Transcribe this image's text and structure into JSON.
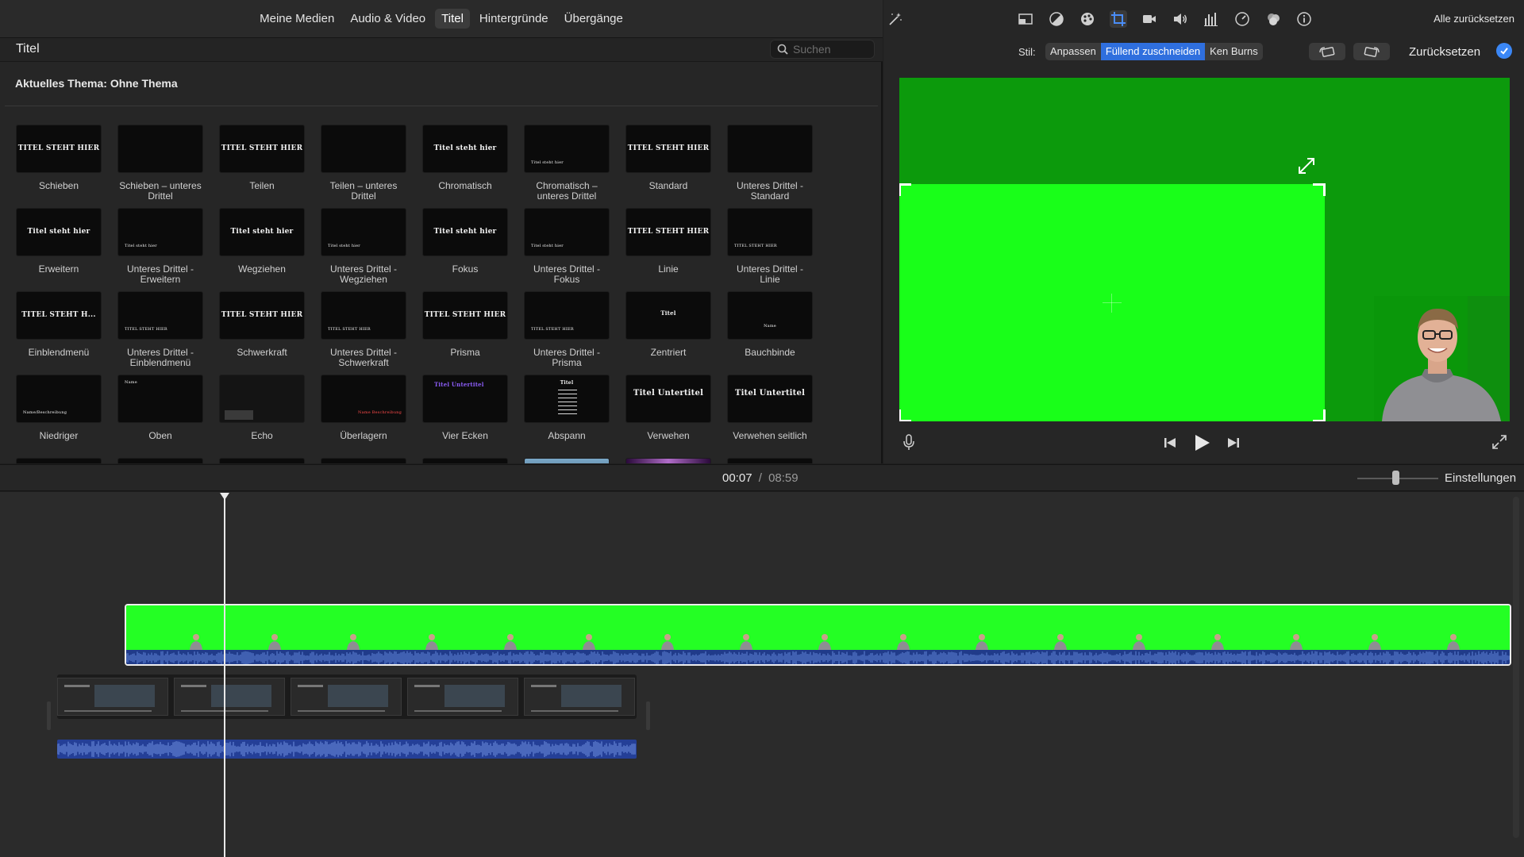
{
  "browser": {
    "tabs": [
      {
        "label": "Meine Medien",
        "active": false
      },
      {
        "label": "Audio & Video",
        "active": false
      },
      {
        "label": "Titel",
        "active": true
      },
      {
        "label": "Hintergründe",
        "active": false
      },
      {
        "label": "Übergänge",
        "active": false
      }
    ],
    "section_title": "Titel",
    "search_placeholder": "Suchen",
    "theme_title": "Aktuelles Thema: Ohne Thema",
    "titles": [
      {
        "label": "Schieben",
        "preview": "TITEL STEHT HIER"
      },
      {
        "label": "Schieben – unteres Drittel",
        "preview": ""
      },
      {
        "label": "Teilen",
        "preview": "TITEL STEHT HIER"
      },
      {
        "label": "Teilen – unteres Drittel",
        "preview": ""
      },
      {
        "label": "Chromatisch",
        "preview": "Titel steht hier"
      },
      {
        "label": "Chromatisch – unteres Drittel",
        "preview": "Titel steht hier"
      },
      {
        "label": "Standard",
        "preview": "TITEL STEHT HIER"
      },
      {
        "label": "Unteres Drittel - Standard",
        "preview": ""
      },
      {
        "label": "Erweitern",
        "preview": "Titel steht hier"
      },
      {
        "label": "Unteres Drittel - Erweitern",
        "preview": "Titel steht hier"
      },
      {
        "label": "Wegziehen",
        "preview": "Titel steht hier"
      },
      {
        "label": "Unteres Drittel - Wegziehen",
        "preview": "Titel steht hier"
      },
      {
        "label": "Fokus",
        "preview": "Titel steht hier"
      },
      {
        "label": "Unteres Drittel - Fokus",
        "preview": "Titel steht hier"
      },
      {
        "label": "Linie",
        "preview": "TITEL STEHT HIER"
      },
      {
        "label": "Unteres Drittel - Linie",
        "preview": "TITEL STEHT HIER"
      },
      {
        "label": "Einblendmenü",
        "preview": "TITEL STEHT H..."
      },
      {
        "label": "Unteres Drittel - Einblendmenü",
        "preview": "TITEL STEHT HIER"
      },
      {
        "label": "Schwerkraft",
        "preview": "TITEL STEHT HIER"
      },
      {
        "label": "Unteres Drittel - Schwerkraft",
        "preview": "TITEL STEHT HIER"
      },
      {
        "label": "Prisma",
        "preview": "TITEL STEHT HIER"
      },
      {
        "label": "Unteres Drittel - Prisma",
        "preview": "TITEL STEHT HIER"
      },
      {
        "label": "Zentriert",
        "preview": "Titel"
      },
      {
        "label": "Bauchbinde",
        "preview": "Name"
      },
      {
        "label": "Niedriger",
        "preview": "Name/Beschreibung"
      },
      {
        "label": "Oben",
        "preview": "Name"
      },
      {
        "label": "Echo",
        "preview": ""
      },
      {
        "label": "Überlagern",
        "preview": "Name Beschreibung"
      },
      {
        "label": "Vier Ecken",
        "preview": "Titel Untertitel"
      },
      {
        "label": "Abspann",
        "preview": "Titel"
      },
      {
        "label": "Verwehen",
        "preview": "Titel Untertitel"
      },
      {
        "label": "Verwehen seitlich",
        "preview": "Titel Untertitel"
      }
    ]
  },
  "viewer": {
    "reset_all": "Alle zurücksetzen",
    "style_label": "Stil:",
    "style_options": [
      {
        "label": "Anpassen",
        "active": false
      },
      {
        "label": "Füllend zuschneiden",
        "active": true
      },
      {
        "label": "Ken Burns",
        "active": false
      }
    ],
    "reset_label": "Zurücksetzen",
    "icons": [
      "magic-wand-icon",
      "crop-overlay-icon",
      "color-balance-icon",
      "color-palette-icon",
      "crop-icon",
      "camera-icon",
      "volume-icon",
      "equalizer-icon",
      "speed-icon",
      "filter-icon",
      "info-icon"
    ],
    "accent": "#2f6fde",
    "canvas_green": "#0c9a0c",
    "crop_green": "#19ff19"
  },
  "timeline": {
    "current_time": "00:07",
    "separator": "/",
    "total_time": "08:59",
    "settings_label": "Einstellungen"
  }
}
